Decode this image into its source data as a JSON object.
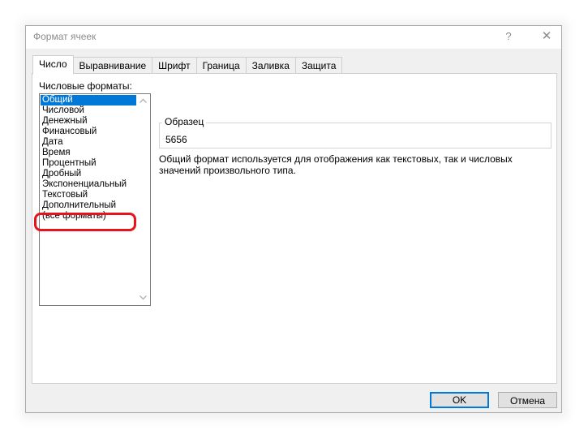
{
  "dialog": {
    "title": "Формат ячеек",
    "help_glyph": "?",
    "close_glyph": "✕"
  },
  "tabs": [
    {
      "label": "Число",
      "active": true
    },
    {
      "label": "Выравнивание",
      "active": false
    },
    {
      "label": "Шрифт",
      "active": false
    },
    {
      "label": "Граница",
      "active": false
    },
    {
      "label": "Заливка",
      "active": false
    },
    {
      "label": "Защита",
      "active": false
    }
  ],
  "formats": {
    "label": "Числовые форматы:",
    "items": [
      "Общий",
      "Числовой",
      "Денежный",
      "Финансовый",
      "Дата",
      "Время",
      "Процентный",
      "Дробный",
      "Экспоненциальный",
      "Текстовый",
      "Дополнительный",
      "(все форматы)"
    ],
    "selected_index": 0,
    "highlighted_item": "Текстовый"
  },
  "sample": {
    "legend": "Образец",
    "value": "5656"
  },
  "description": "Общий формат используется для отображения как текстовых, так и числовых значений произвольного типа.",
  "buttons": {
    "ok": "OK",
    "cancel": "Отмена"
  },
  "colors": {
    "selection": "#0078d7",
    "highlight_ring": "#e8141b",
    "dialog_bg": "#f0f0f0"
  },
  "icons": {
    "scroll_up": "chevron-up-icon",
    "scroll_down": "chevron-down-icon"
  }
}
